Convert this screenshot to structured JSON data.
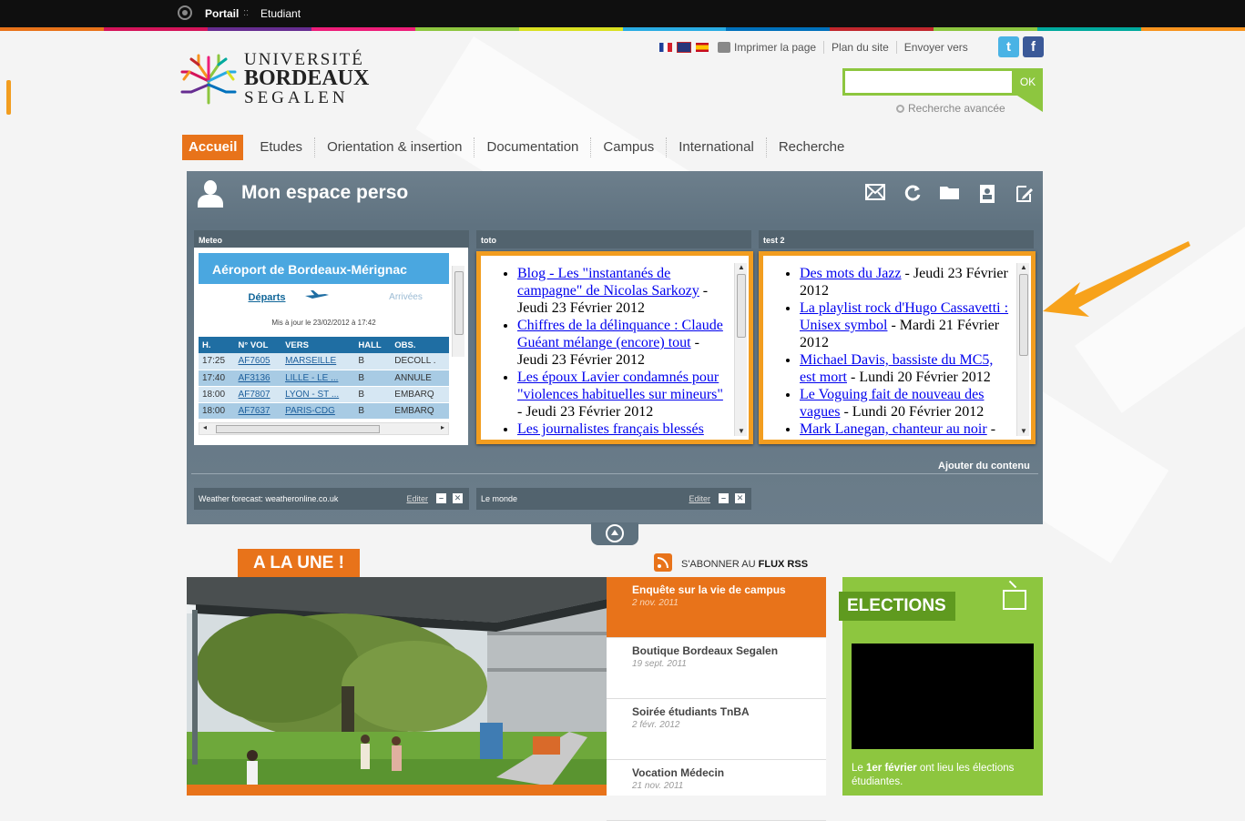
{
  "topbar": {
    "portal": "Portail",
    "separator": "::",
    "section": "Etudiant"
  },
  "colors": {
    "accent_orange": "#e8731a",
    "green": "#8dc63f",
    "panel": "#607380",
    "highlight": "#f29d1f",
    "colorbar": [
      "#e8731a",
      "#d4145a",
      "#662d91",
      "#ed1e79",
      "#8dc63f",
      "#d9e021",
      "#29abe2",
      "#0071bc",
      "#c1272d",
      "#8cc63f",
      "#00a99d",
      "#f7931e"
    ]
  },
  "logo": {
    "line1": "UNIVERSITÉ",
    "line2": "BORDEAUX",
    "line3": "SEGALEN"
  },
  "utility": {
    "print": "Imprimer la page",
    "sitemap": "Plan du site",
    "send": "Envoyer vers",
    "twitter_icon": "t",
    "facebook_icon": "f"
  },
  "search": {
    "value": "",
    "placeholder": "",
    "ok": "OK",
    "advanced": "Recherche avancée"
  },
  "nav": [
    "Accueil",
    "Etudes",
    "Orientation & insertion",
    "Documentation",
    "Campus",
    "International",
    "Recherche"
  ],
  "perso": {
    "title": "Mon espace perso",
    "icons": [
      "mail-icon",
      "sync-icon",
      "folder-icon",
      "contacts-icon",
      "edit-icon"
    ],
    "add_content": "Ajouter du contenu"
  },
  "widgets": {
    "meteo": {
      "title": "Meteo",
      "airport": "Aéroport de Bordeaux-Mérignac",
      "tab_departures": "Départs",
      "tab_arrivals": "Arrivées",
      "updated": "Mis à jour le 23/02/2012 à 17:42",
      "columns": [
        "H.",
        "N° VOL",
        "VERS",
        "HALL",
        "OBS."
      ],
      "flights": [
        [
          "17:25",
          "AF7605",
          "MARSEILLE",
          "B",
          "DECOLL ."
        ],
        [
          "17:40",
          "AF3136",
          "LILLE - LE ...",
          "B",
          "ANNULE"
        ],
        [
          "18:00",
          "AF7807",
          "LYON - ST ...",
          "B",
          "EMBARQ"
        ],
        [
          "18:00",
          "AF7637",
          "PARIS-CDG",
          "B",
          "EMBARQ"
        ]
      ]
    },
    "toto": {
      "title": "toto",
      "items": [
        {
          "link": "Blog - Les \"instantanés de campagne\" de Nicolas Sarkozy",
          "date": " - Jeudi 23 Février 2012"
        },
        {
          "link": "Chiffres de la délinquance : Claude Guéant mélange (encore) tout",
          "date": " - Jeudi 23 Février 2012"
        },
        {
          "link": "Les époux Lavier condamnés pour \"violences habituelles sur mineurs\"",
          "date": " - Jeudi 23 Février 2012"
        },
        {
          "link": "Les journalistes français blessés",
          "date": ""
        }
      ]
    },
    "test2": {
      "title": "test 2",
      "items": [
        {
          "link": "Des mots du Jazz",
          "date": " - Jeudi 23 Février 2012"
        },
        {
          "link": "La playlist rock d'Hugo Cassavetti : Unisex symbol",
          "date": " - Mardi 21 Février 2012"
        },
        {
          "link": "Michael Davis, bassiste du MC5, est mort",
          "date": " - Lundi 20 Février 2012"
        },
        {
          "link": "Le Voguing fait de nouveau des vagues",
          "date": " - Lundi 20 Février 2012"
        },
        {
          "link": "Mark Lanegan, chanteur au noir",
          "date": " -"
        }
      ]
    },
    "mini": [
      {
        "title": "Weather forecast: weatheronline.co.uk",
        "edit": "Editer"
      },
      {
        "title": "Le monde",
        "edit": "Editer"
      }
    ]
  },
  "alaune": {
    "label": "A LA UNE !",
    "rss_prefix": "S'ABONNER AU",
    "rss_bold": "FLUX RSS",
    "news": [
      {
        "title": "Enquête sur la vie de campus",
        "date": "2 nov. 2011"
      },
      {
        "title": "Boutique Bordeaux Segalen",
        "date": "19 sept. 2011"
      },
      {
        "title": "Soirée étudiants TnBA",
        "date": "2 févr. 2012"
      },
      {
        "title": "Vocation Médecin",
        "date": "21 nov. 2011"
      }
    ]
  },
  "elections": {
    "title": "ELECTIONS",
    "text_pre": "Le",
    "text_bold": "1er février",
    "text_post": "ont lieu les élections étudiantes."
  }
}
